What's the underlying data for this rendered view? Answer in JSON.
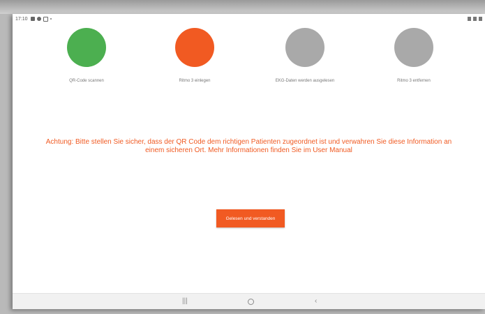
{
  "status_bar": {
    "time": "17:10"
  },
  "steps": [
    {
      "label": "QR-Code scannen",
      "color": "#4caf50",
      "state": "done"
    },
    {
      "label": "Ritmo 3 einlegen",
      "color": "#f15a22",
      "state": "active"
    },
    {
      "label": "EKG-Daten werden ausgelesen",
      "color": "#a9a9a9",
      "state": "pending"
    },
    {
      "label": "Ritmo 3 entfernen",
      "color": "#a9a9a9",
      "state": "pending"
    }
  ],
  "warning": {
    "line1": "Achtung: Bitte stellen Sie sicher, dass der QR Code dem richtigen Patienten zugeordnet ist und verwahren Sie diese Information an",
    "line2": "einem sicheren Ort. Mehr Informationen finden Sie im User Manual"
  },
  "confirm_button": {
    "label": "Gelesen und verstanden"
  },
  "nav_bar": {
    "recents_icon": "|||",
    "home_icon": "circle",
    "back_icon": "‹"
  },
  "colors": {
    "accent": "#f15a22",
    "done": "#4caf50",
    "pending": "#a9a9a9"
  }
}
